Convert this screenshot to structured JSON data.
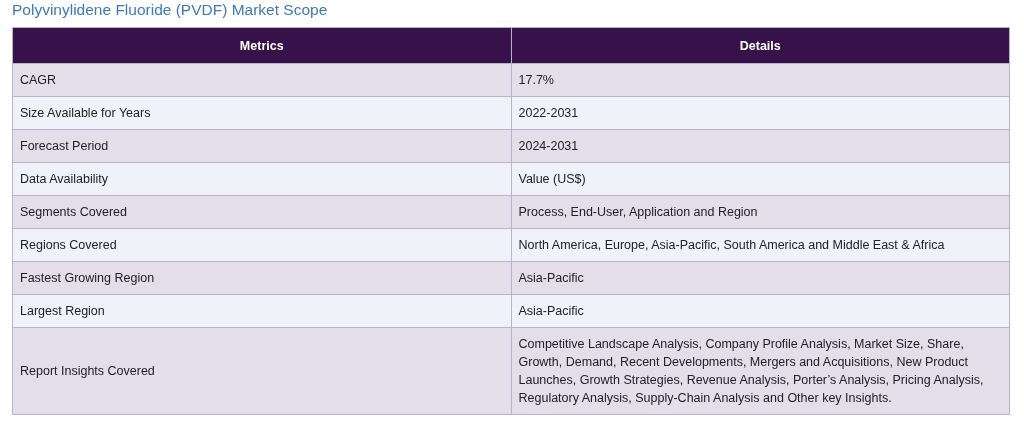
{
  "title": "Polyvinylidene Fluoride (PVDF) Market Scope",
  "table": {
    "columns": [
      "Metrics",
      "Details"
    ],
    "rows": [
      {
        "metric": "CAGR",
        "details": "17.7%"
      },
      {
        "metric": "Size Available for Years",
        "details": "2022-2031"
      },
      {
        "metric": "Forecast Period",
        "details": "2024-2031"
      },
      {
        "metric": "Data Availability",
        "details": "Value (US$)"
      },
      {
        "metric": "Segments Covered",
        "details": "Process, End-User, Application and Region"
      },
      {
        "metric": "Regions Covered",
        "details": "North America, Europe, Asia-Pacific, South America and Middle East & Africa"
      },
      {
        "metric": "Fastest Growing Region",
        "details": "Asia-Pacific"
      },
      {
        "metric": "Largest Region",
        "details": "Asia-Pacific"
      },
      {
        "metric": "Report Insights Covered",
        "details": "Competitive Landscape Analysis, Company Profile Analysis, Market Size, Share, Growth, Demand, Recent Developments, Mergers and Acquisitions, New Product Launches, Growth Strategies, Revenue Analysis, Porter’s Analysis, Pricing Analysis, Regulatory Analysis, Supply-Chain Analysis and Other key Insights."
      }
    ]
  }
}
